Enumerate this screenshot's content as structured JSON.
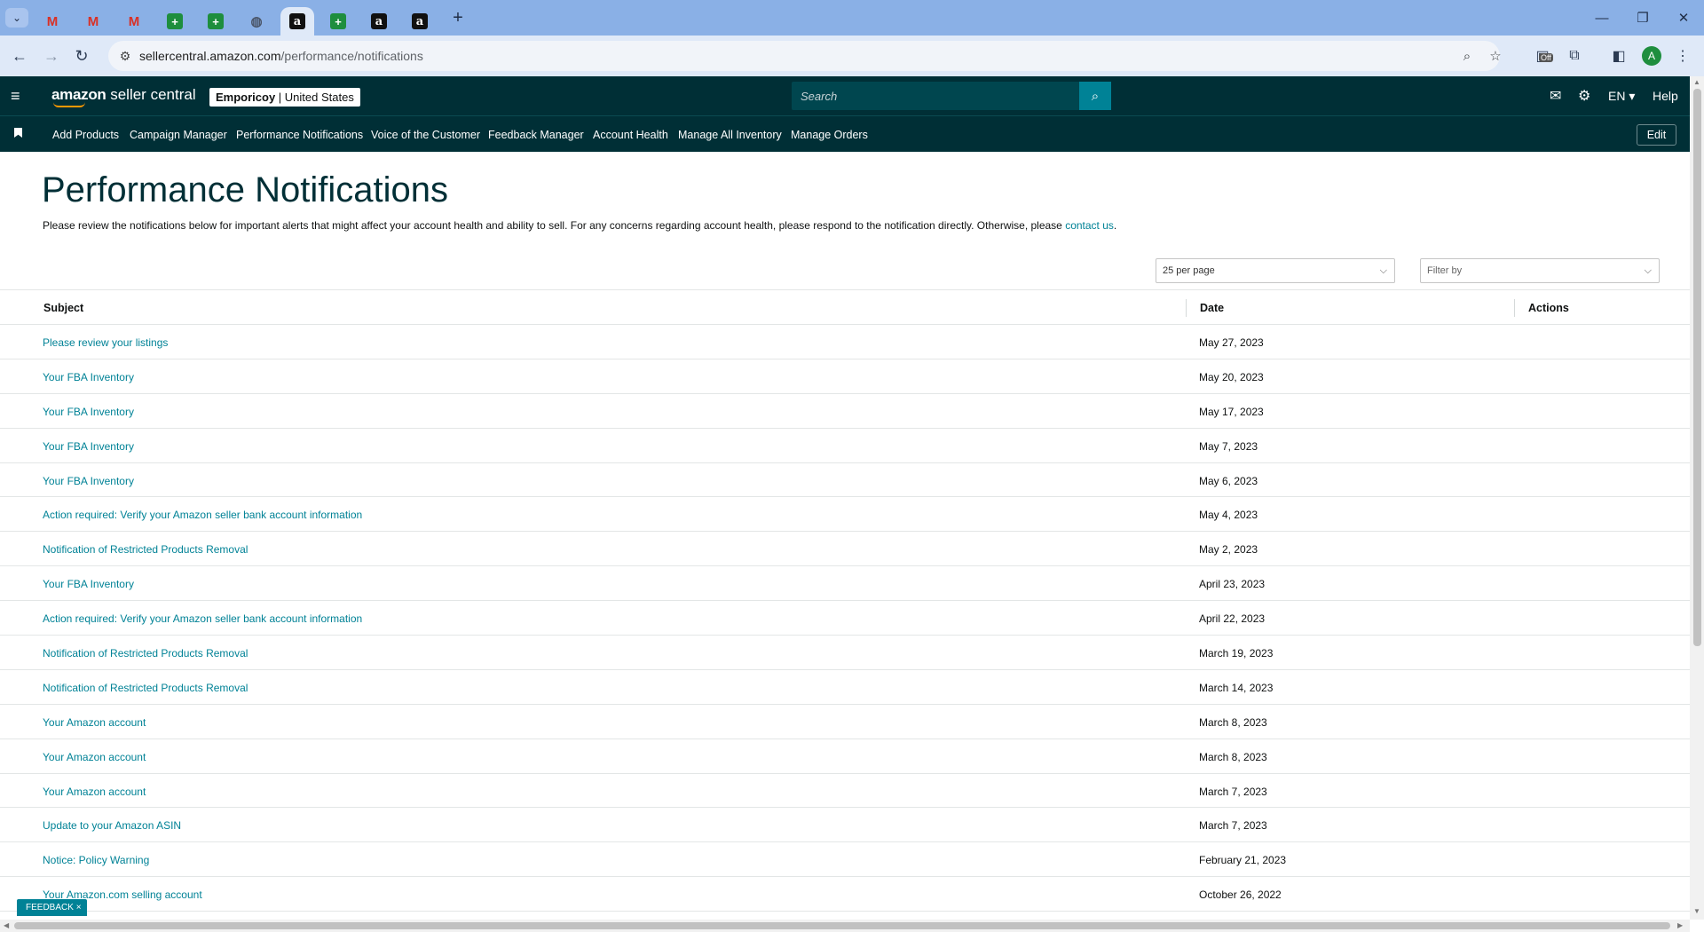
{
  "browser": {
    "tabs": [
      {
        "icon": "gmail-icon",
        "glyph": "M"
      },
      {
        "icon": "gmail-icon",
        "glyph": "M"
      },
      {
        "icon": "gmail-icon",
        "glyph": "M"
      },
      {
        "icon": "sheets-icon",
        "glyph": "+"
      },
      {
        "icon": "sheets-icon",
        "glyph": "+"
      },
      {
        "icon": "globe-icon",
        "glyph": "◍"
      },
      {
        "icon": "amazon-icon",
        "glyph": "a",
        "active": true
      },
      {
        "icon": "sheets-icon",
        "glyph": "+"
      },
      {
        "icon": "amazon-icon",
        "glyph": "a"
      },
      {
        "icon": "amazon-icon",
        "glyph": "a"
      }
    ],
    "url_host": "sellercentral.amazon.com",
    "url_path": "/performance/notifications",
    "extension_badge": "Off",
    "profile_initial": "A"
  },
  "header": {
    "logo_bold": "amazon",
    "logo_rest": " seller central",
    "store_bold": "Emporicoy",
    "store_rest": " | United States",
    "search_placeholder": "Search",
    "language": "EN",
    "help": "Help"
  },
  "nav": {
    "links": [
      "Add Products",
      "Campaign Manager",
      "Performance Notifications",
      "Voice of the Customer",
      "Feedback Manager",
      "Account Health",
      "Manage All Inventory",
      "Manage Orders"
    ],
    "edit_label": "Edit"
  },
  "page": {
    "title": "Performance Notifications",
    "description": "Please review the notifications below for important alerts that might affect your account health and ability to sell. For any concerns regarding account health, please respond to the notification directly. Otherwise, please ",
    "contact_link": "contact us",
    "description_end": ".",
    "per_page": "25 per page",
    "filter_placeholder": "Filter by"
  },
  "table": {
    "headers": {
      "subject": "Subject",
      "date": "Date",
      "actions": "Actions"
    },
    "rows": [
      {
        "subject": "Please review your listings",
        "date": "May 27, 2023"
      },
      {
        "subject": "Your FBA Inventory",
        "date": "May 20, 2023"
      },
      {
        "subject": "Your FBA Inventory",
        "date": "May 17, 2023"
      },
      {
        "subject": "Your FBA Inventory",
        "date": "May 7, 2023"
      },
      {
        "subject": "Your FBA Inventory",
        "date": "May 6, 2023"
      },
      {
        "subject": "Action required: Verify your Amazon seller bank account information",
        "date": "May 4, 2023"
      },
      {
        "subject": "Notification of Restricted Products Removal",
        "date": "May 2, 2023"
      },
      {
        "subject": "Your FBA Inventory",
        "date": "April 23, 2023"
      },
      {
        "subject": "Action required: Verify your Amazon seller bank account information",
        "date": "April 22, 2023"
      },
      {
        "subject": "Notification of Restricted Products Removal",
        "date": "March 19, 2023"
      },
      {
        "subject": "Notification of Restricted Products Removal",
        "date": "March 14, 2023"
      },
      {
        "subject": "Your Amazon account",
        "date": "March 8, 2023"
      },
      {
        "subject": "Your Amazon account",
        "date": "March 8, 2023"
      },
      {
        "subject": "Your Amazon account",
        "date": "March 7, 2023"
      },
      {
        "subject": "Update to your Amazon ASIN",
        "date": "March 7, 2023"
      },
      {
        "subject": "Notice: Policy Warning",
        "date": "February 21, 2023"
      },
      {
        "subject": "Your Amazon.com selling account",
        "date": "October 26, 2022"
      }
    ]
  },
  "feedback": {
    "label": "FEEDBACK",
    "close": "×"
  },
  "colors": {
    "header_bg": "#002f36",
    "link": "#008296",
    "tabstrip": "#8ab0e6"
  }
}
